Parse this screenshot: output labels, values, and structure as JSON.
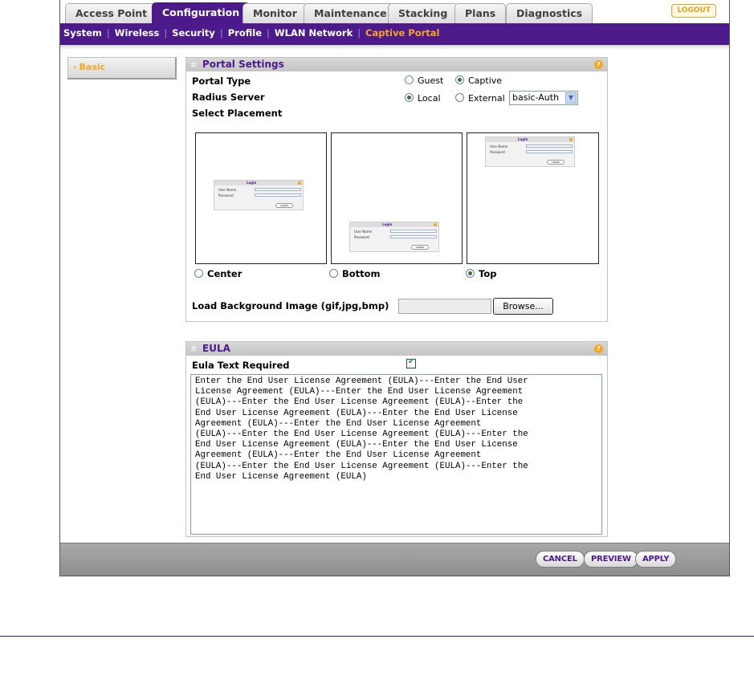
{
  "tabs": [
    {
      "label": "Access Point",
      "active": false
    },
    {
      "label": "Configuration",
      "active": true
    },
    {
      "label": "Monitor",
      "active": false
    },
    {
      "label": "Maintenance",
      "active": false
    },
    {
      "label": "Stacking",
      "active": false
    },
    {
      "label": "Plans",
      "active": false
    },
    {
      "label": "Diagnostics",
      "active": false
    }
  ],
  "logout_label": "LOGOUT",
  "subnav": [
    "System",
    "Wireless",
    "Security",
    "Profile",
    "WLAN Network",
    "Captive Portal"
  ],
  "subnav_current": "Captive Portal",
  "leftnav": {
    "chevron": "›",
    "label": "Basic"
  },
  "portal": {
    "title": "Portal Settings",
    "help": "?",
    "portal_type_label": "Portal Type",
    "portal_type_options": [
      "Guest",
      "Captive"
    ],
    "portal_type_selected": "Captive",
    "radius_label": "Radius Server",
    "radius_options": [
      "Local",
      "External"
    ],
    "radius_selected": "Local",
    "radius_select_value": "basic-Auth",
    "placement_label": "Select Placement",
    "placement_options": [
      "Center",
      "Bottom",
      "Top"
    ],
    "placement_selected": "Top",
    "preview": {
      "title": "Login",
      "user": "User Name",
      "pass": "Password",
      "button": "LOGIN"
    },
    "bg_label": "Load Background Image (gif,jpg,bmp)",
    "browse_label": "Browse..."
  },
  "eula": {
    "title": "EULA",
    "help": "?",
    "required_label": "Eula Text Required",
    "required_checked": true,
    "text": "Enter the End User License Agreement (EULA)---Enter the End User\nLicense Agreement (EULA)---Enter the End User License Agreement\n(EULA)---Enter the End User License Agreement (EULA)--Enter the\nEnd User License Agreement (EULA)---Enter the End User License\nAgreement (EULA)---Enter the End User License Agreement\n(EULA)---Enter the End User License Agreement (EULA)---Enter the\nEnd User License Agreement (EULA)---Enter the End User License\nAgreement (EULA)---Enter the End User License Agreement\n(EULA)---Enter the End User License Agreement (EULA)---Enter the\nEnd User License Agreement (EULA)"
  },
  "footer": {
    "cancel": "CANCEL",
    "preview": "PREVIEW",
    "apply": "APPLY"
  },
  "colors": {
    "brand_purple": "#4c1a8a",
    "accent_orange": "#f5a623",
    "footer_gray": "#9c9c9c"
  }
}
